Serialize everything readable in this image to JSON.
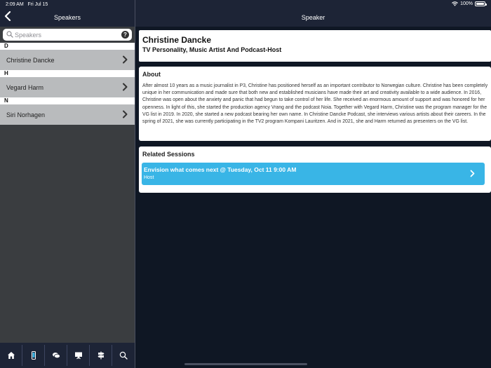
{
  "status": {
    "time": "2:09 AM",
    "date": "Fri Jul 15",
    "battery": "100%",
    "battery_level": 1.0
  },
  "left": {
    "title": "Speakers",
    "search_placeholder": "Speakers",
    "sections": [
      {
        "letter": "D",
        "speakers": [
          "Christine Dancke"
        ]
      },
      {
        "letter": "H",
        "speakers": [
          "Vegard Harm"
        ]
      },
      {
        "letter": "N",
        "speakers": [
          "Siri Norhagen"
        ]
      }
    ],
    "tabs": [
      "home-icon",
      "phone-icon",
      "chat-icon",
      "presentation-icon",
      "map-icon",
      "search-icon"
    ]
  },
  "right": {
    "title": "Speaker",
    "speaker_name": "Christine Dancke",
    "speaker_title": "TV Personality, Music Artist And Podcast-Host",
    "about_heading": "About",
    "about_text": "After almost 10 years as a music journalist in P3, Christine has positioned herself as an important contributor to Norwegian culture. Christine has been completely unique in her communication and made sure that both new and established musicians have made their art and creativity available to a wide audience. In 2016, Christine was open about the anxiety and panic that had begun to take control of her life. She received an enormous amount of support and was honored for her openness. In light of this, she started the production agency Vrang and the podcast Noia. Together with Vegard Harm, Christine was the program manager for the VG list in 2019. In 2020, she started a new podcast bearing her own name. In Christine Dancke Podcast, she interviews various artists about their careers. In the spring of 2021, she was currently participating in the TV2 program Kompani Lauritzen. And in 2021, she and Harm returned as presenters on the VG list.",
    "sessions_heading": "Related Sessions",
    "session": {
      "title": "Envision what comes next @ Tuesday, Oct 11 9:00 AM",
      "role": "Host"
    }
  },
  "colors": {
    "header_bg": "#1d2436",
    "accent": "#39b5e6",
    "row_bg": "#b9bbbd"
  }
}
